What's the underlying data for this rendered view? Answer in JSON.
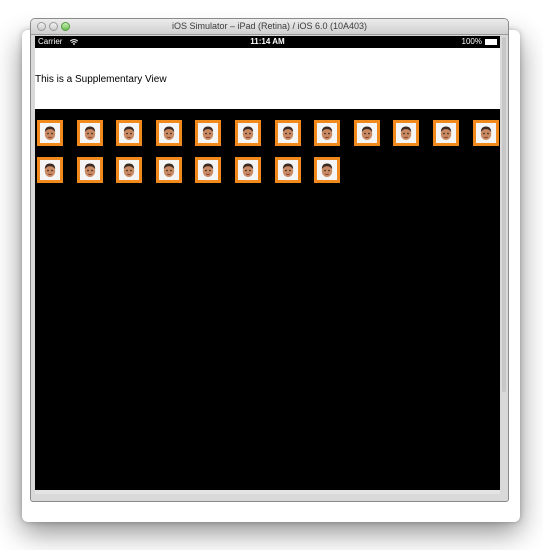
{
  "window": {
    "title": "iOS Simulator – iPad (Retina) / iOS 6.0 (10A403)"
  },
  "status_bar": {
    "carrier": "Carrier",
    "time": "11:14 AM",
    "battery": "100%"
  },
  "supplementary_view": {
    "text": "This is a Supplementary View"
  },
  "collection": {
    "item_icon": "face-icon",
    "accent_color": "#f08a1c",
    "background_color": "#000000",
    "item_count": 20
  }
}
